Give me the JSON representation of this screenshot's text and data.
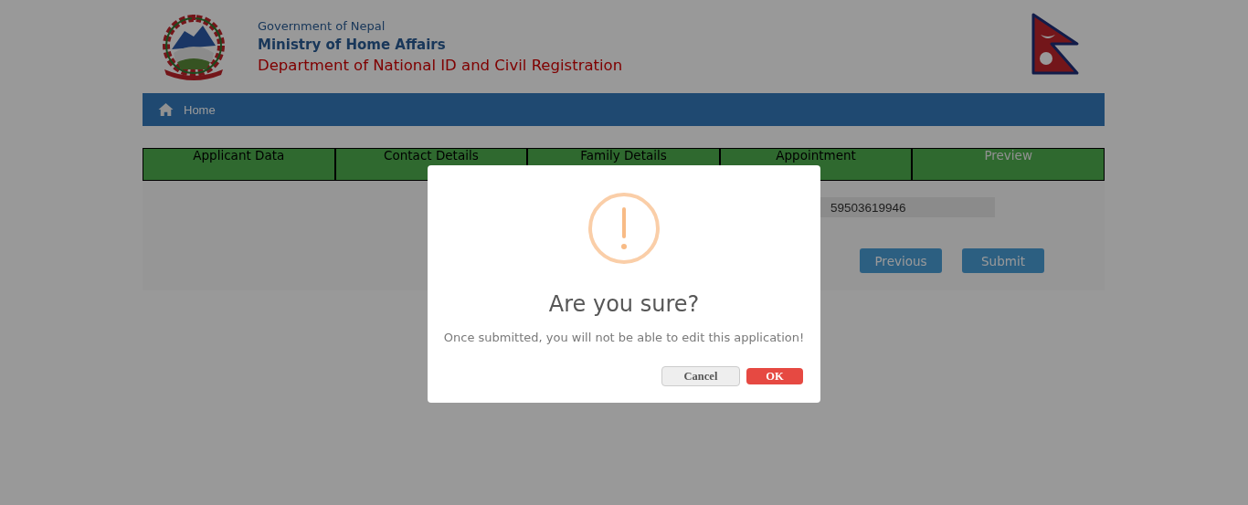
{
  "header": {
    "line_1": "Government of Nepal",
    "line_2": "Ministry of Home Affairs",
    "line_3": "Department of National ID and Civil Registration"
  },
  "nav": {
    "items": [
      {
        "label": "Home"
      }
    ]
  },
  "tabs": [
    {
      "label": "Applicant Data",
      "selected": false
    },
    {
      "label": "Contact Details",
      "selected": false
    },
    {
      "label": "Family Details",
      "selected": false
    },
    {
      "label": "Appointment",
      "selected": false
    },
    {
      "label": "Preview",
      "selected": true
    }
  ],
  "form": {
    "field_value": "59503619946",
    "buttons": [
      "Previous",
      "Submit"
    ]
  },
  "dialog": {
    "title": "Are you sure?",
    "message": "Once submitted, you will not be able to edit this application!",
    "buttons": [
      {
        "label": "Cancel",
        "kind": "cancel"
      },
      {
        "label": "OK",
        "kind": "confirm"
      }
    ]
  }
}
